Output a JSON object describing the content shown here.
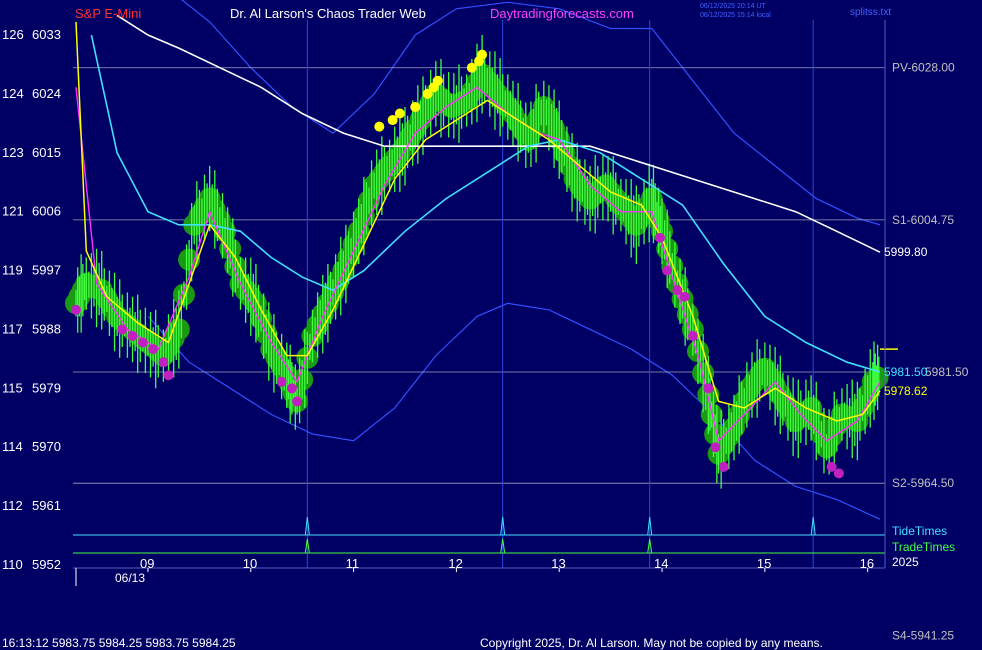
{
  "header": {
    "instrument": "S&P E-Mini",
    "title": "Dr. Al Larson's Chaos Trader Web",
    "site": "Daytradingforecasts.com",
    "timestamp_line1": "06/12/2025 20:14 UT",
    "timestamp_line2": "06/12/2025 15:14 local",
    "corner_label": "splitss.txt"
  },
  "footer": {
    "quote_line": "16:13:12  5983.75  5984.25  5983.75  5984.25",
    "copyright": "Copyright 2025, Dr. Al Larson. May not be copied by any means.",
    "year": "2025",
    "date_label": "06/13"
  },
  "colors": {
    "background": "#000064",
    "title": "#ffffff",
    "instrument": "#ff3030",
    "site": "#ff40ff",
    "price": "#40ff40",
    "ma_fast": "#ffff00",
    "ma_slow": "#ff30ff",
    "ma_mid": "#40e0ff",
    "ma_long": "#ffffff",
    "band": "#3050ff",
    "level_line": "#a0a0c0",
    "tide": "#40e0ff",
    "trade": "#40ff40"
  },
  "chart_data": {
    "type": "line",
    "title": "S&P E-Mini",
    "y_left_ticks": [
      {
        "a": "126",
        "b": "6033"
      },
      {
        "a": "124",
        "b": "6024"
      },
      {
        "a": "123",
        "b": "6015"
      },
      {
        "a": "121",
        "b": "6006"
      },
      {
        "a": "119",
        "b": "5997"
      },
      {
        "a": "117",
        "b": "5988"
      },
      {
        "a": "115",
        "b": "5979"
      },
      {
        "a": "114",
        "b": "5970"
      },
      {
        "a": "112",
        "b": "5961"
      },
      {
        "a": "110",
        "b": "5952"
      }
    ],
    "y_values": [
      6033,
      6024,
      6015,
      6006,
      5997,
      5988,
      5979,
      5970,
      5961,
      5952
    ],
    "ylim": [
      5952,
      6033
    ],
    "x_labels": [
      "09",
      "10",
      "11",
      "12",
      "13",
      "14",
      "15",
      "16"
    ],
    "x_hours": [
      9,
      10,
      11,
      12,
      13,
      14,
      15,
      16
    ],
    "xlim": [
      8.3,
      16.12
    ],
    "levels": [
      {
        "label": "PV-6028.00",
        "value": 6028.0
      },
      {
        "label": "S1-6004.75",
        "value": 6004.75
      },
      {
        "label": "S2-5964.50",
        "value": 5964.5
      },
      {
        "label": "S4-5941.25",
        "value": 5941.25
      }
    ],
    "level_5981": {
      "value": 5981.5,
      "label": "5981.50",
      "side_label": "5981.50"
    },
    "last_values": {
      "long_ma": "5999.80",
      "fast_ma": "5978.62"
    },
    "tide_times": {
      "label": "TideTimes",
      "hours": [
        10.55,
        12.45,
        13.88,
        15.47
      ]
    },
    "trade_times": {
      "label": "TradeTimes",
      "hours": [
        10.55,
        12.45,
        13.88
      ]
    },
    "price_series": [
      {
        "h": 8.3,
        "v": 5992
      },
      {
        "h": 8.4,
        "v": 5995
      },
      {
        "h": 8.55,
        "v": 5994
      },
      {
        "h": 8.7,
        "v": 5990
      },
      {
        "h": 8.85,
        "v": 5988
      },
      {
        "h": 9.0,
        "v": 5986
      },
      {
        "h": 9.15,
        "v": 5984
      },
      {
        "h": 9.3,
        "v": 5988
      },
      {
        "h": 9.45,
        "v": 6004
      },
      {
        "h": 9.6,
        "v": 6008
      },
      {
        "h": 9.75,
        "v": 6003
      },
      {
        "h": 9.9,
        "v": 5995
      },
      {
        "h": 10.05,
        "v": 5992
      },
      {
        "h": 10.2,
        "v": 5985
      },
      {
        "h": 10.35,
        "v": 5981
      },
      {
        "h": 10.45,
        "v": 5977
      },
      {
        "h": 10.6,
        "v": 5987
      },
      {
        "h": 10.75,
        "v": 5992
      },
      {
        "h": 10.9,
        "v": 5997
      },
      {
        "h": 11.05,
        "v": 6003
      },
      {
        "h": 11.2,
        "v": 6010
      },
      {
        "h": 11.35,
        "v": 6013
      },
      {
        "h": 11.5,
        "v": 6016
      },
      {
        "h": 11.65,
        "v": 6020
      },
      {
        "h": 11.8,
        "v": 6024
      },
      {
        "h": 11.95,
        "v": 6022
      },
      {
        "h": 12.1,
        "v": 6023
      },
      {
        "h": 12.25,
        "v": 6027
      },
      {
        "h": 12.4,
        "v": 6024
      },
      {
        "h": 12.55,
        "v": 6021
      },
      {
        "h": 12.7,
        "v": 6017
      },
      {
        "h": 12.85,
        "v": 6022
      },
      {
        "h": 13.0,
        "v": 6017
      },
      {
        "h": 13.15,
        "v": 6011
      },
      {
        "h": 13.3,
        "v": 6008
      },
      {
        "h": 13.45,
        "v": 6010
      },
      {
        "h": 13.6,
        "v": 6007
      },
      {
        "h": 13.75,
        "v": 6004
      },
      {
        "h": 13.9,
        "v": 6008
      },
      {
        "h": 14.0,
        "v": 6003
      },
      {
        "h": 14.15,
        "v": 5995
      },
      {
        "h": 14.3,
        "v": 5988
      },
      {
        "h": 14.45,
        "v": 5978
      },
      {
        "h": 14.55,
        "v": 5969
      },
      {
        "h": 14.7,
        "v": 5973
      },
      {
        "h": 14.85,
        "v": 5979
      },
      {
        "h": 15.0,
        "v": 5982
      },
      {
        "h": 15.15,
        "v": 5978
      },
      {
        "h": 15.3,
        "v": 5974
      },
      {
        "h": 15.45,
        "v": 5976
      },
      {
        "h": 15.6,
        "v": 5970
      },
      {
        "h": 15.75,
        "v": 5975
      },
      {
        "h": 15.9,
        "v": 5974
      },
      {
        "h": 16.05,
        "v": 5980
      },
      {
        "h": 16.12,
        "v": 5981
      }
    ],
    "fast_ma": [
      {
        "h": 8.3,
        "v": 6035
      },
      {
        "h": 8.4,
        "v": 6000
      },
      {
        "h": 8.6,
        "v": 5993
      },
      {
        "h": 8.9,
        "v": 5989
      },
      {
        "h": 9.2,
        "v": 5986
      },
      {
        "h": 9.4,
        "v": 5995
      },
      {
        "h": 9.6,
        "v": 6004
      },
      {
        "h": 9.85,
        "v": 5999
      },
      {
        "h": 10.1,
        "v": 5991
      },
      {
        "h": 10.35,
        "v": 5984
      },
      {
        "h": 10.55,
        "v": 5984
      },
      {
        "h": 10.8,
        "v": 5991
      },
      {
        "h": 11.1,
        "v": 6001
      },
      {
        "h": 11.4,
        "v": 6011
      },
      {
        "h": 11.7,
        "v": 6017
      },
      {
        "h": 12.0,
        "v": 6020
      },
      {
        "h": 12.3,
        "v": 6023
      },
      {
        "h": 12.6,
        "v": 6020
      },
      {
        "h": 12.9,
        "v": 6017
      },
      {
        "h": 13.2,
        "v": 6013
      },
      {
        "h": 13.5,
        "v": 6009
      },
      {
        "h": 13.8,
        "v": 6007
      },
      {
        "h": 14.0,
        "v": 6002
      },
      {
        "h": 14.3,
        "v": 5990
      },
      {
        "h": 14.55,
        "v": 5977
      },
      {
        "h": 14.8,
        "v": 5976
      },
      {
        "h": 15.1,
        "v": 5979
      },
      {
        "h": 15.4,
        "v": 5976
      },
      {
        "h": 15.7,
        "v": 5974
      },
      {
        "h": 15.95,
        "v": 5975
      },
      {
        "h": 16.12,
        "v": 5978.62
      }
    ],
    "slow_ma": [
      {
        "h": 8.3,
        "v": 6025
      },
      {
        "h": 8.5,
        "v": 5995
      },
      {
        "h": 8.8,
        "v": 5988
      },
      {
        "h": 9.1,
        "v": 5985
      },
      {
        "h": 9.4,
        "v": 5996
      },
      {
        "h": 9.6,
        "v": 6006
      },
      {
        "h": 9.9,
        "v": 5995
      },
      {
        "h": 10.2,
        "v": 5986
      },
      {
        "h": 10.45,
        "v": 5980
      },
      {
        "h": 10.7,
        "v": 5990
      },
      {
        "h": 11.0,
        "v": 6000
      },
      {
        "h": 11.3,
        "v": 6010
      },
      {
        "h": 11.6,
        "v": 6018
      },
      {
        "h": 11.9,
        "v": 6022
      },
      {
        "h": 12.2,
        "v": 6025
      },
      {
        "h": 12.5,
        "v": 6021
      },
      {
        "h": 12.8,
        "v": 6018
      },
      {
        "h": 13.0,
        "v": 6017
      },
      {
        "h": 13.3,
        "v": 6010
      },
      {
        "h": 13.6,
        "v": 6006
      },
      {
        "h": 13.9,
        "v": 6006
      },
      {
        "h": 14.1,
        "v": 5996
      },
      {
        "h": 14.35,
        "v": 5984
      },
      {
        "h": 14.55,
        "v": 5971
      },
      {
        "h": 14.8,
        "v": 5975
      },
      {
        "h": 15.1,
        "v": 5980
      },
      {
        "h": 15.35,
        "v": 5975
      },
      {
        "h": 15.6,
        "v": 5971
      },
      {
        "h": 15.9,
        "v": 5974
      },
      {
        "h": 16.12,
        "v": 5980
      }
    ],
    "mid_ma": [
      {
        "h": 8.45,
        "v": 6033
      },
      {
        "h": 8.7,
        "v": 6015
      },
      {
        "h": 9.0,
        "v": 6006
      },
      {
        "h": 9.3,
        "v": 6004
      },
      {
        "h": 9.6,
        "v": 6004
      },
      {
        "h": 9.9,
        "v": 6003
      },
      {
        "h": 10.2,
        "v": 5999
      },
      {
        "h": 10.5,
        "v": 5996
      },
      {
        "h": 10.8,
        "v": 5994
      },
      {
        "h": 11.1,
        "v": 5997
      },
      {
        "h": 11.5,
        "v": 6003
      },
      {
        "h": 11.9,
        "v": 6008
      },
      {
        "h": 12.3,
        "v": 6012
      },
      {
        "h": 12.7,
        "v": 6016
      },
      {
        "h": 13.0,
        "v": 6017
      },
      {
        "h": 13.4,
        "v": 6015
      },
      {
        "h": 13.8,
        "v": 6011
      },
      {
        "h": 14.2,
        "v": 6007
      },
      {
        "h": 14.6,
        "v": 5998
      },
      {
        "h": 15.0,
        "v": 5990
      },
      {
        "h": 15.4,
        "v": 5986
      },
      {
        "h": 15.8,
        "v": 5983
      },
      {
        "h": 16.12,
        "v": 5981.5
      }
    ],
    "long_ma": [
      {
        "h": 8.7,
        "v": 6036
      },
      {
        "h": 9.0,
        "v": 6033
      },
      {
        "h": 9.3,
        "v": 6031
      },
      {
        "h": 9.7,
        "v": 6028
      },
      {
        "h": 10.1,
        "v": 6025
      },
      {
        "h": 10.5,
        "v": 6021
      },
      {
        "h": 10.9,
        "v": 6018
      },
      {
        "h": 11.3,
        "v": 6016
      },
      {
        "h": 11.7,
        "v": 6016
      },
      {
        "h": 12.1,
        "v": 6016
      },
      {
        "h": 12.5,
        "v": 6016
      },
      {
        "h": 12.9,
        "v": 6016
      },
      {
        "h": 13.3,
        "v": 6016
      },
      {
        "h": 13.7,
        "v": 6014
      },
      {
        "h": 14.1,
        "v": 6012
      },
      {
        "h": 14.5,
        "v": 6010
      },
      {
        "h": 14.9,
        "v": 6008
      },
      {
        "h": 15.3,
        "v": 6006
      },
      {
        "h": 15.7,
        "v": 6003
      },
      {
        "h": 16.12,
        "v": 5999.8
      }
    ],
    "upper_band": [
      {
        "h": 9.2,
        "v": 6040
      },
      {
        "h": 9.6,
        "v": 6035
      },
      {
        "h": 10.0,
        "v": 6028
      },
      {
        "h": 10.4,
        "v": 6022
      },
      {
        "h": 10.8,
        "v": 6018
      },
      {
        "h": 11.2,
        "v": 6024
      },
      {
        "h": 11.6,
        "v": 6033
      },
      {
        "h": 12.0,
        "v": 6037
      },
      {
        "h": 12.5,
        "v": 6038
      },
      {
        "h": 13.0,
        "v": 6037
      },
      {
        "h": 13.5,
        "v": 6034
      },
      {
        "h": 13.9,
        "v": 6034
      },
      {
        "h": 14.3,
        "v": 6026
      },
      {
        "h": 14.7,
        "v": 6018
      },
      {
        "h": 15.1,
        "v": 6013
      },
      {
        "h": 15.5,
        "v": 6008
      },
      {
        "h": 15.9,
        "v": 6005
      },
      {
        "h": 16.12,
        "v": 6004
      }
    ],
    "lower_band": [
      {
        "h": 9.0,
        "v": 5990
      },
      {
        "h": 9.4,
        "v": 5983
      },
      {
        "h": 9.8,
        "v": 5979
      },
      {
        "h": 10.2,
        "v": 5975
      },
      {
        "h": 10.6,
        "v": 5972
      },
      {
        "h": 11.0,
        "v": 5971
      },
      {
        "h": 11.4,
        "v": 5976
      },
      {
        "h": 11.8,
        "v": 5984
      },
      {
        "h": 12.2,
        "v": 5990
      },
      {
        "h": 12.5,
        "v": 5992
      },
      {
        "h": 12.9,
        "v": 5991
      },
      {
        "h": 13.3,
        "v": 5988
      },
      {
        "h": 13.7,
        "v": 5985
      },
      {
        "h": 14.1,
        "v": 5981
      },
      {
        "h": 14.5,
        "v": 5975
      },
      {
        "h": 14.9,
        "v": 5968
      },
      {
        "h": 15.3,
        "v": 5964
      },
      {
        "h": 15.7,
        "v": 5962
      },
      {
        "h": 16.12,
        "v": 5959
      }
    ],
    "yellow_markers": [
      {
        "h": 11.25,
        "v": 6019
      },
      {
        "h": 11.38,
        "v": 6020
      },
      {
        "h": 11.45,
        "v": 6021
      },
      {
        "h": 11.6,
        "v": 6022
      },
      {
        "h": 11.72,
        "v": 6024
      },
      {
        "h": 11.78,
        "v": 6025
      },
      {
        "h": 11.82,
        "v": 6026
      },
      {
        "h": 12.15,
        "v": 6028
      },
      {
        "h": 12.22,
        "v": 6029
      },
      {
        "h": 12.25,
        "v": 6030
      }
    ],
    "magenta_markers": [
      {
        "h": 8.3,
        "v": 5991
      },
      {
        "h": 8.75,
        "v": 5988
      },
      {
        "h": 8.85,
        "v": 5987
      },
      {
        "h": 8.95,
        "v": 5986
      },
      {
        "h": 9.05,
        "v": 5985
      },
      {
        "h": 9.15,
        "v": 5983
      },
      {
        "h": 9.2,
        "v": 5981
      },
      {
        "h": 10.3,
        "v": 5980
      },
      {
        "h": 10.4,
        "v": 5979
      },
      {
        "h": 10.45,
        "v": 5977
      },
      {
        "h": 13.98,
        "v": 6002
      },
      {
        "h": 14.05,
        "v": 5997
      },
      {
        "h": 14.15,
        "v": 5994
      },
      {
        "h": 14.22,
        "v": 5993
      },
      {
        "h": 14.3,
        "v": 5987
      },
      {
        "h": 14.45,
        "v": 5979
      },
      {
        "h": 14.52,
        "v": 5970
      },
      {
        "h": 14.6,
        "v": 5967
      },
      {
        "h": 15.65,
        "v": 5967
      },
      {
        "h": 15.72,
        "v": 5966
      }
    ]
  }
}
